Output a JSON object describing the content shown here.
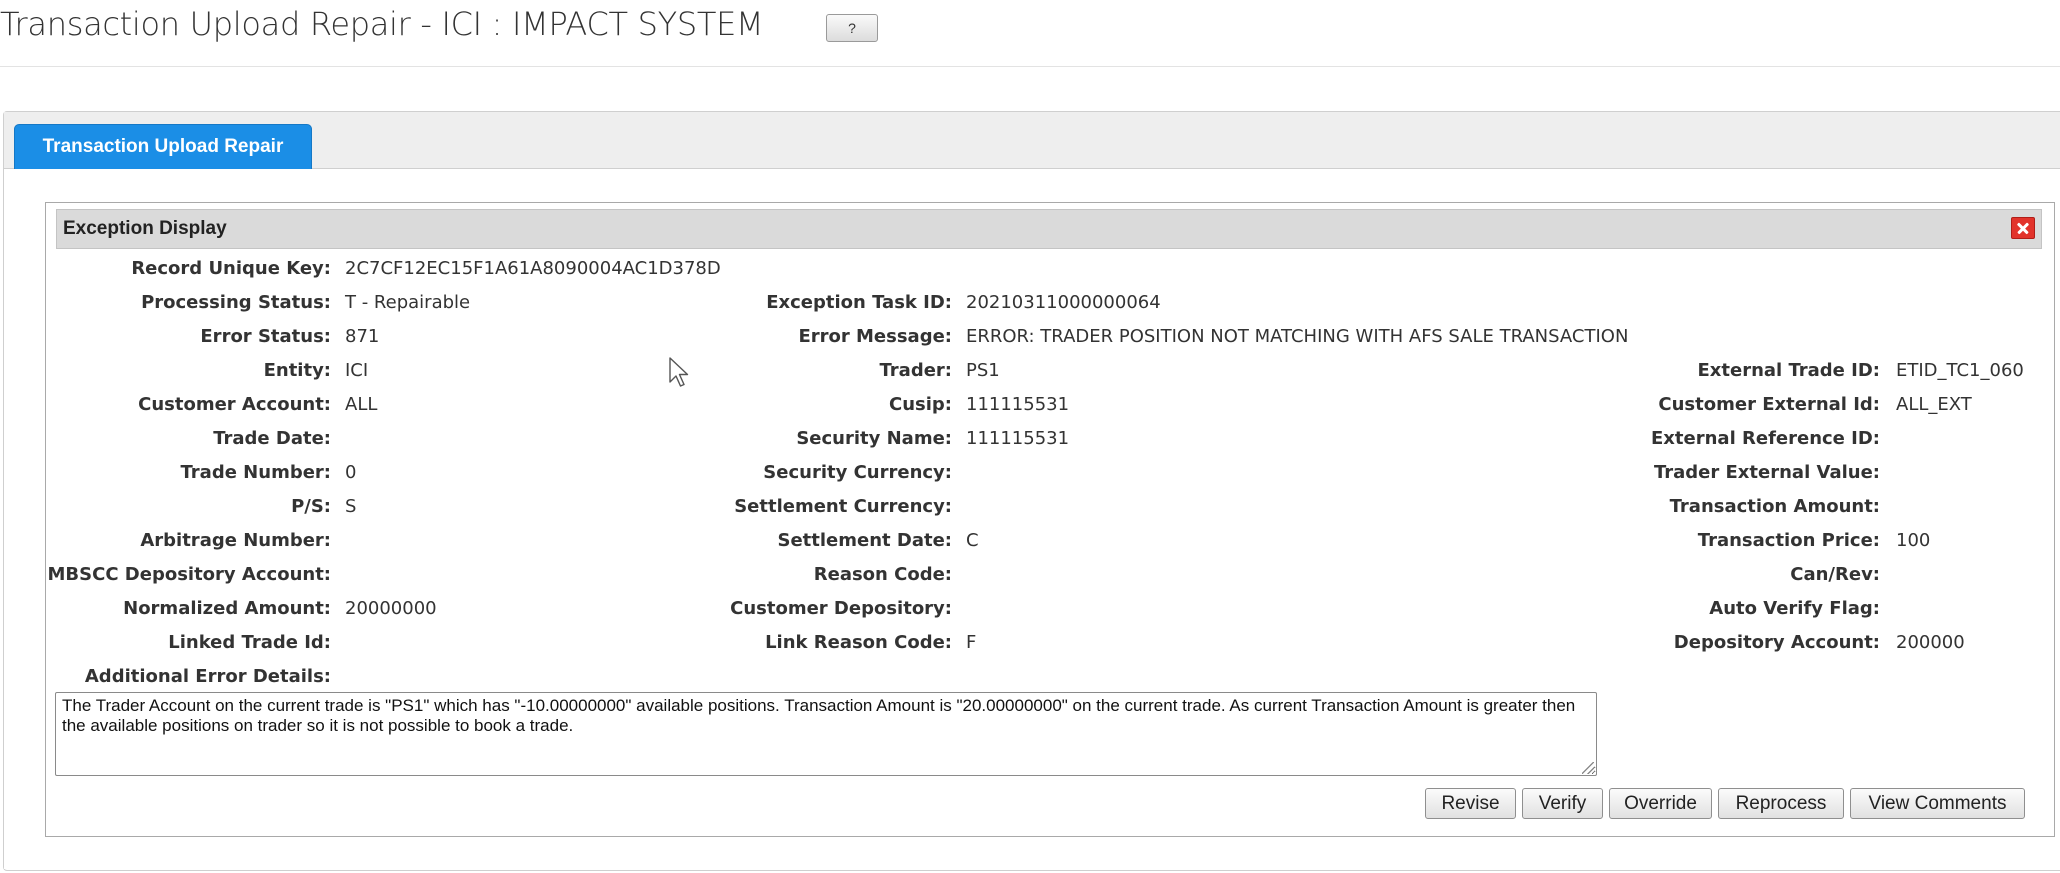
{
  "page": {
    "title": "Transaction Upload Repair - ICI : IMPACT SYSTEM",
    "help_label": "?"
  },
  "tabs": [
    {
      "label": "Transaction Upload Repair",
      "active": true
    }
  ],
  "exception": {
    "title": "Exception Display",
    "close_icon": "close-icon",
    "fields": {
      "record_unique_key": {
        "label": "Record Unique Key:",
        "value": "2C7CF12EC15F1A61A8090004AC1D378D"
      },
      "processing_status": {
        "label": "Processing Status:",
        "value": "T - Repairable"
      },
      "error_status": {
        "label": "Error Status:",
        "value": "871"
      },
      "entity": {
        "label": "Entity:",
        "value": "ICI"
      },
      "customer_account": {
        "label": "Customer Account:",
        "value": "ALL"
      },
      "trade_date": {
        "label": "Trade Date:",
        "value": ""
      },
      "trade_number": {
        "label": "Trade Number:",
        "value": "0"
      },
      "ps": {
        "label": "P/S:",
        "value": "S"
      },
      "arbitrage_number": {
        "label": "Arbitrage Number:",
        "value": ""
      },
      "mbscc_depository_account": {
        "label": "MBSCC Depository Account:",
        "value": ""
      },
      "normalized_amount": {
        "label": "Normalized Amount:",
        "value": "20000000"
      },
      "linked_trade_id": {
        "label": "Linked Trade Id:",
        "value": ""
      },
      "additional_error_details": {
        "label": "Additional Error Details:",
        "value": ""
      },
      "exception_task_id": {
        "label": "Exception Task ID:",
        "value": "20210311000000064"
      },
      "error_message": {
        "label": "Error Message:",
        "value": "ERROR: TRADER POSITION NOT MATCHING WITH AFS SALE TRANSACTION"
      },
      "trader": {
        "label": "Trader:",
        "value": "PS1"
      },
      "cusip": {
        "label": "Cusip:",
        "value": "111115531"
      },
      "security_name": {
        "label": "Security Name:",
        "value": "111115531"
      },
      "security_currency": {
        "label": "Security Currency:",
        "value": ""
      },
      "settlement_currency": {
        "label": "Settlement Currency:",
        "value": ""
      },
      "settlement_date": {
        "label": "Settlement Date:",
        "value": "C"
      },
      "reason_code": {
        "label": "Reason Code:",
        "value": ""
      },
      "customer_depository": {
        "label": "Customer Depository:",
        "value": ""
      },
      "link_reason_code": {
        "label": "Link Reason Code:",
        "value": "F"
      },
      "external_trade_id": {
        "label": "External Trade ID:",
        "value": "ETID_TC1_060"
      },
      "customer_external_id": {
        "label": "Customer External Id:",
        "value": "ALL_EXT"
      },
      "external_reference_id": {
        "label": "External Reference ID:",
        "value": ""
      },
      "trader_external_value": {
        "label": "Trader External Value:",
        "value": ""
      },
      "transaction_amount": {
        "label": "Transaction Amount:",
        "value": ""
      },
      "transaction_price": {
        "label": "Transaction Price:",
        "value": "100"
      },
      "can_rev": {
        "label": "Can/Rev:",
        "value": ""
      },
      "auto_verify_flag": {
        "label": "Auto Verify Flag:",
        "value": ""
      },
      "depository_account": {
        "label": "Depository Account:",
        "value": "200000"
      }
    },
    "details_text": "The Trader Account on the current trade is \"PS1\" which has \"-10.00000000\" available positions. Transaction Amount is \"20.00000000\" on the current trade. As current Transaction Amount is greater then the available positions on trader so it is not possible to book a trade."
  },
  "actions": {
    "revise": "Revise",
    "verify": "Verify",
    "override": "Override",
    "reprocess": "Reprocess",
    "view_comments": "View Comments"
  },
  "colors": {
    "tab_active": "#1b8ee6",
    "close_red": "#e2332b",
    "header_gray": "#dadada"
  }
}
